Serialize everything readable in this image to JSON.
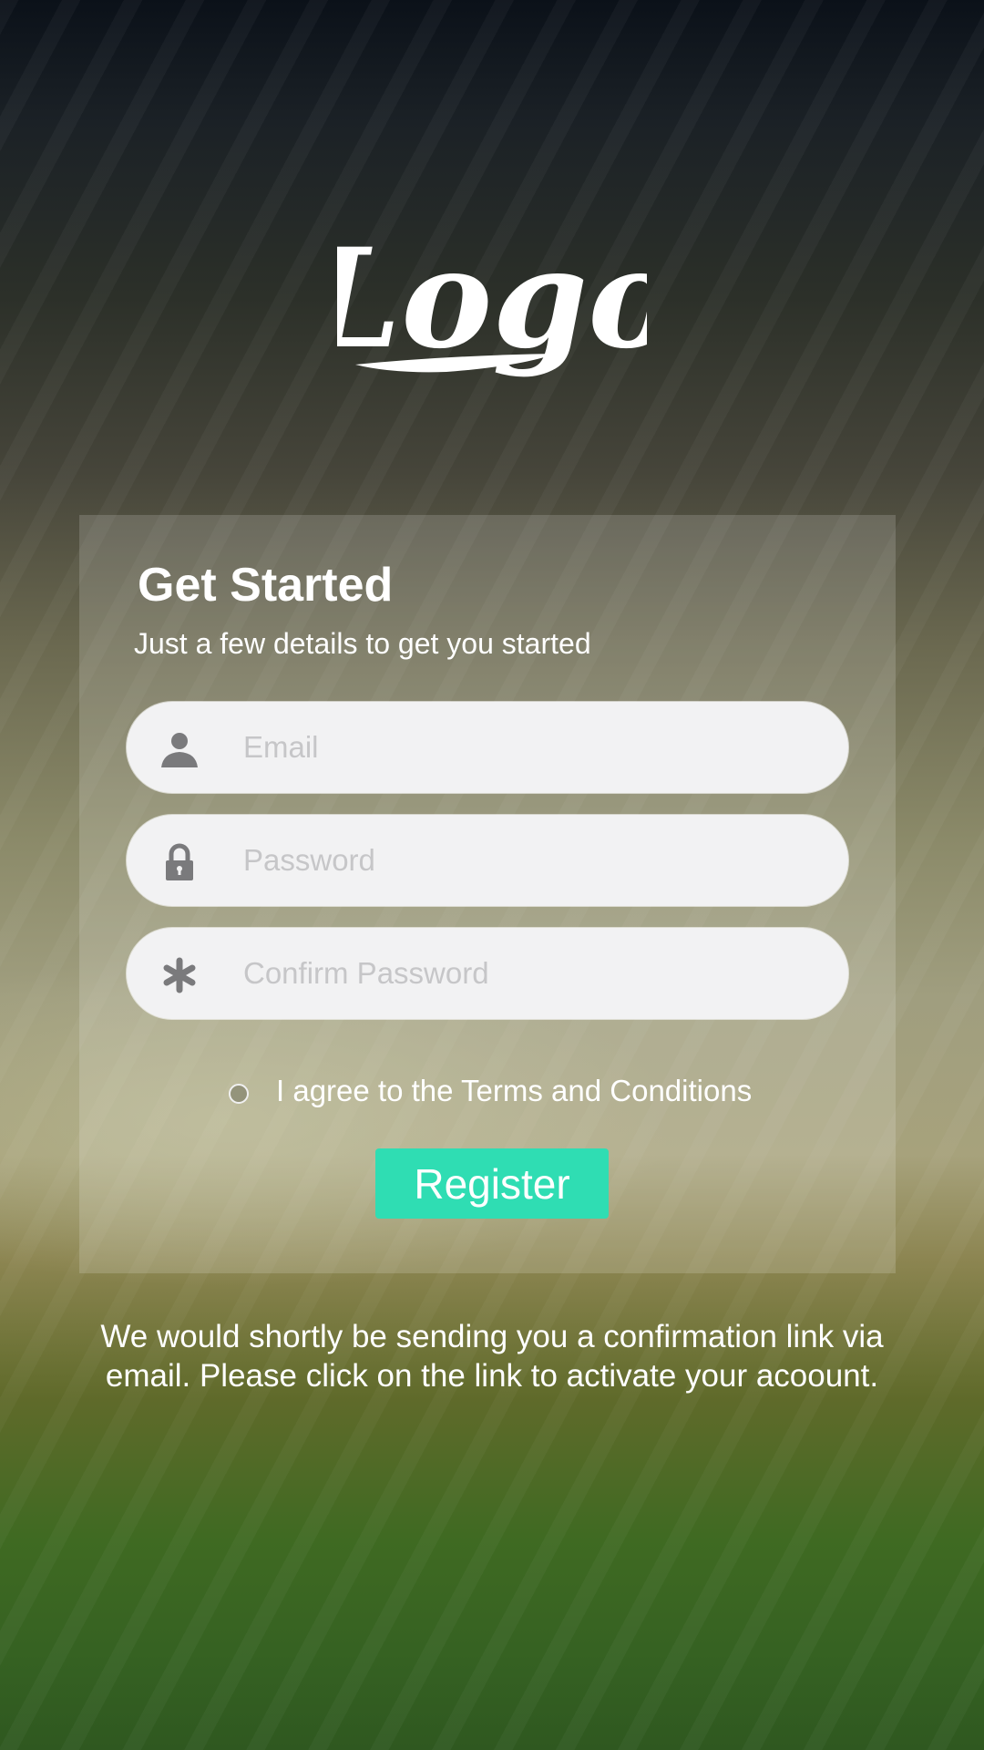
{
  "logo": {
    "text": "Logo"
  },
  "card": {
    "title": "Get Started",
    "subtitle": "Just a few details to get you started"
  },
  "fields": {
    "email": {
      "placeholder": "Email",
      "icon": "user-icon"
    },
    "password": {
      "placeholder": "Password",
      "icon": "lock-icon"
    },
    "confirm_password": {
      "placeholder": "Confirm Password",
      "icon": "asterisk-icon"
    }
  },
  "agree": {
    "label": "I agree to the Terms and Conditions",
    "checked": false
  },
  "register": {
    "label": "Register",
    "color": "#2fddb3"
  },
  "footer": {
    "note": "We would shortly be sending you a confirmation link via email. Please click on the link to activate your acoount."
  }
}
